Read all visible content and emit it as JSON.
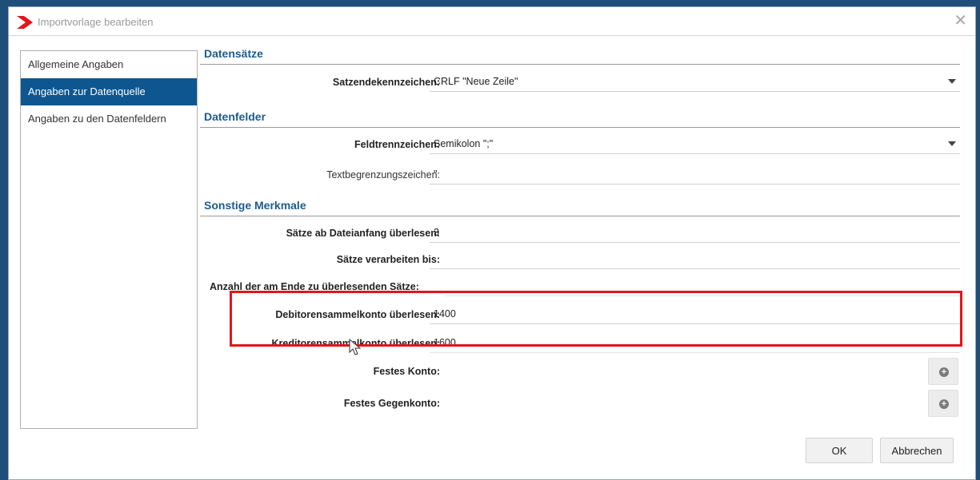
{
  "window": {
    "title": "Importvorlage bearbeiten",
    "close_glyph": "✕",
    "brand_color": "#e3141b",
    "accent_color": "#0e5690"
  },
  "nav": {
    "items": [
      {
        "label": "Allgemeine Angaben",
        "active": false
      },
      {
        "label": "Angaben zur Datenquelle",
        "active": true
      },
      {
        "label": "Angaben zu den Datenfeldern",
        "active": false
      }
    ]
  },
  "sections": {
    "datensaetze": {
      "title": "Datensätze",
      "satzende_label": "Satzendekennzeichen:",
      "satzende_value": "CRLF \"Neue Zeile\""
    },
    "datenfelder": {
      "title": "Datenfelder",
      "feldtrenn_label": "Feldtrennzeichen:",
      "feldtrenn_value": "Semikolon \";\"",
      "textbegr_label": "Textbegrenzungszeichen:",
      "textbegr_value": "\""
    },
    "sonstige": {
      "title": "Sonstige Merkmale",
      "saetze_ab_label": "Sätze ab Dateianfang überlesen:",
      "saetze_ab_value": "3",
      "saetze_bis_label": "Sätze verarbeiten bis:",
      "saetze_bis_value": "",
      "anzahl_label": "Anzahl der am Ende zu überlesenden Sätze:",
      "anzahl_value": "",
      "debitoren_label": "Debitorensammelkonto überlesen:",
      "debitoren_value": "1400",
      "kreditoren_label": "Kreditorensammelkonto überlesen:",
      "kreditoren_value": "1600",
      "festes_konto_label": "Festes Konto:",
      "festes_gegenkonto_label": "Festes Gegenkonto:",
      "add_glyph": "+"
    }
  },
  "buttons": {
    "ok": "OK",
    "cancel": "Abbrechen"
  },
  "highlight_color": "#e3141b"
}
